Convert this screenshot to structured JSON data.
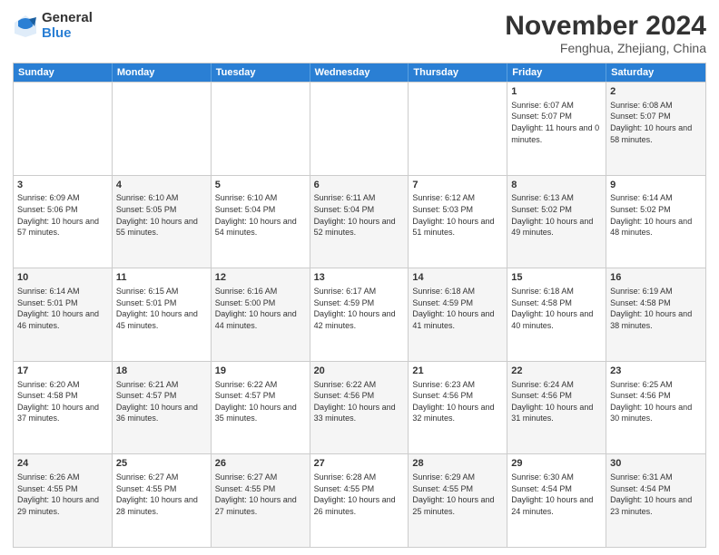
{
  "header": {
    "logo_general": "General",
    "logo_blue": "Blue",
    "month_title": "November 2024",
    "location": "Fenghua, Zhejiang, China"
  },
  "calendar": {
    "days_of_week": [
      "Sunday",
      "Monday",
      "Tuesday",
      "Wednesday",
      "Thursday",
      "Friday",
      "Saturday"
    ],
    "weeks": [
      [
        {
          "day": "",
          "info": "",
          "shaded": false
        },
        {
          "day": "",
          "info": "",
          "shaded": false
        },
        {
          "day": "",
          "info": "",
          "shaded": false
        },
        {
          "day": "",
          "info": "",
          "shaded": false
        },
        {
          "day": "",
          "info": "",
          "shaded": false
        },
        {
          "day": "1",
          "info": "Sunrise: 6:07 AM\nSunset: 5:07 PM\nDaylight: 11 hours and 0 minutes.",
          "shaded": false
        },
        {
          "day": "2",
          "info": "Sunrise: 6:08 AM\nSunset: 5:07 PM\nDaylight: 10 hours and 58 minutes.",
          "shaded": true
        }
      ],
      [
        {
          "day": "3",
          "info": "Sunrise: 6:09 AM\nSunset: 5:06 PM\nDaylight: 10 hours and 57 minutes.",
          "shaded": false
        },
        {
          "day": "4",
          "info": "Sunrise: 6:10 AM\nSunset: 5:05 PM\nDaylight: 10 hours and 55 minutes.",
          "shaded": true
        },
        {
          "day": "5",
          "info": "Sunrise: 6:10 AM\nSunset: 5:04 PM\nDaylight: 10 hours and 54 minutes.",
          "shaded": false
        },
        {
          "day": "6",
          "info": "Sunrise: 6:11 AM\nSunset: 5:04 PM\nDaylight: 10 hours and 52 minutes.",
          "shaded": true
        },
        {
          "day": "7",
          "info": "Sunrise: 6:12 AM\nSunset: 5:03 PM\nDaylight: 10 hours and 51 minutes.",
          "shaded": false
        },
        {
          "day": "8",
          "info": "Sunrise: 6:13 AM\nSunset: 5:02 PM\nDaylight: 10 hours and 49 minutes.",
          "shaded": true
        },
        {
          "day": "9",
          "info": "Sunrise: 6:14 AM\nSunset: 5:02 PM\nDaylight: 10 hours and 48 minutes.",
          "shaded": false
        }
      ],
      [
        {
          "day": "10",
          "info": "Sunrise: 6:14 AM\nSunset: 5:01 PM\nDaylight: 10 hours and 46 minutes.",
          "shaded": true
        },
        {
          "day": "11",
          "info": "Sunrise: 6:15 AM\nSunset: 5:01 PM\nDaylight: 10 hours and 45 minutes.",
          "shaded": false
        },
        {
          "day": "12",
          "info": "Sunrise: 6:16 AM\nSunset: 5:00 PM\nDaylight: 10 hours and 44 minutes.",
          "shaded": true
        },
        {
          "day": "13",
          "info": "Sunrise: 6:17 AM\nSunset: 4:59 PM\nDaylight: 10 hours and 42 minutes.",
          "shaded": false
        },
        {
          "day": "14",
          "info": "Sunrise: 6:18 AM\nSunset: 4:59 PM\nDaylight: 10 hours and 41 minutes.",
          "shaded": true
        },
        {
          "day": "15",
          "info": "Sunrise: 6:18 AM\nSunset: 4:58 PM\nDaylight: 10 hours and 40 minutes.",
          "shaded": false
        },
        {
          "day": "16",
          "info": "Sunrise: 6:19 AM\nSunset: 4:58 PM\nDaylight: 10 hours and 38 minutes.",
          "shaded": true
        }
      ],
      [
        {
          "day": "17",
          "info": "Sunrise: 6:20 AM\nSunset: 4:58 PM\nDaylight: 10 hours and 37 minutes.",
          "shaded": false
        },
        {
          "day": "18",
          "info": "Sunrise: 6:21 AM\nSunset: 4:57 PM\nDaylight: 10 hours and 36 minutes.",
          "shaded": true
        },
        {
          "day": "19",
          "info": "Sunrise: 6:22 AM\nSunset: 4:57 PM\nDaylight: 10 hours and 35 minutes.",
          "shaded": false
        },
        {
          "day": "20",
          "info": "Sunrise: 6:22 AM\nSunset: 4:56 PM\nDaylight: 10 hours and 33 minutes.",
          "shaded": true
        },
        {
          "day": "21",
          "info": "Sunrise: 6:23 AM\nSunset: 4:56 PM\nDaylight: 10 hours and 32 minutes.",
          "shaded": false
        },
        {
          "day": "22",
          "info": "Sunrise: 6:24 AM\nSunset: 4:56 PM\nDaylight: 10 hours and 31 minutes.",
          "shaded": true
        },
        {
          "day": "23",
          "info": "Sunrise: 6:25 AM\nSunset: 4:56 PM\nDaylight: 10 hours and 30 minutes.",
          "shaded": false
        }
      ],
      [
        {
          "day": "24",
          "info": "Sunrise: 6:26 AM\nSunset: 4:55 PM\nDaylight: 10 hours and 29 minutes.",
          "shaded": true
        },
        {
          "day": "25",
          "info": "Sunrise: 6:27 AM\nSunset: 4:55 PM\nDaylight: 10 hours and 28 minutes.",
          "shaded": false
        },
        {
          "day": "26",
          "info": "Sunrise: 6:27 AM\nSunset: 4:55 PM\nDaylight: 10 hours and 27 minutes.",
          "shaded": true
        },
        {
          "day": "27",
          "info": "Sunrise: 6:28 AM\nSunset: 4:55 PM\nDaylight: 10 hours and 26 minutes.",
          "shaded": false
        },
        {
          "day": "28",
          "info": "Sunrise: 6:29 AM\nSunset: 4:55 PM\nDaylight: 10 hours and 25 minutes.",
          "shaded": true
        },
        {
          "day": "29",
          "info": "Sunrise: 6:30 AM\nSunset: 4:54 PM\nDaylight: 10 hours and 24 minutes.",
          "shaded": false
        },
        {
          "day": "30",
          "info": "Sunrise: 6:31 AM\nSunset: 4:54 PM\nDaylight: 10 hours and 23 minutes.",
          "shaded": true
        }
      ]
    ]
  }
}
